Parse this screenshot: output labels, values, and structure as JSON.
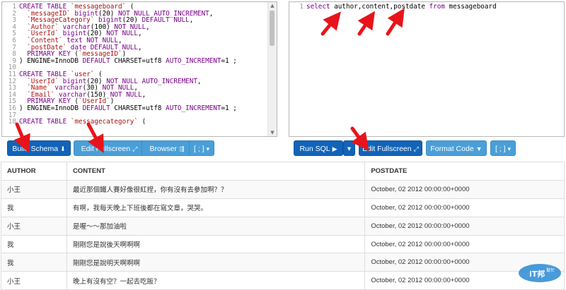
{
  "schema_editor": {
    "line_numbers": [
      "1",
      "2",
      "3",
      "4",
      "5",
      "6",
      "7",
      "8",
      "9",
      "10",
      "11",
      "12",
      "13",
      "14",
      "15",
      "16",
      "17",
      "18"
    ],
    "lines": [
      "CREATE TABLE `messageboard` (",
      "  `messageID` bigint(20) NOT NULL AUTO_INCREMENT,",
      "  `MessageCategory` bigint(20) DEFAULT NULL,",
      "  `Author` varchar(100) NOT NULL,",
      "  `UserId` bigint(20) NOT NULL,",
      "  `Content` text NOT NULL,",
      "  `postDate` date DEFAULT NULL,",
      "  PRIMARY KEY (`messageID`)",
      ") ENGINE=InnoDB DEFAULT CHARSET=utf8 AUTO_INCREMENT=1 ;",
      "",
      "CREATE TABLE `user` (",
      "  `UserId` bigint(20) NOT NULL AUTO_INCREMENT,",
      "  `Name` varchar(30) NOT NULL,",
      "  `Email` varchar(150) NOT NULL,",
      "  PRIMARY KEY (`UserId`)",
      ") ENGINE=InnoDB DEFAULT CHARSET=utf8 AUTO_INCREMENT=1 ;",
      "",
      "CREATE TABLE `messagecategory` ("
    ]
  },
  "sql_editor": {
    "line_number": "1",
    "query": "select author,content,postdate from messageboard"
  },
  "left_toolbar": {
    "build_schema": "Build Schema",
    "edit_fullscreen": "Edit Fullscreen",
    "browser": "Browser",
    "delimiter": "[ ; ]"
  },
  "right_toolbar": {
    "run_sql": "Run SQL",
    "edit_fullscreen": "Edit Fullscreen",
    "format_code": "Format Code",
    "delimiter": "[ ; ]"
  },
  "results": {
    "columns": [
      "AUTHOR",
      "CONTENT",
      "POSTDATE"
    ],
    "rows": [
      [
        "小王",
        "最近那個鐵人賽好像很紅捏，你有沒有去參加啊？？",
        "October, 02 2012 00:00:00+0000"
      ],
      [
        "我",
        "有啊，我每天晚上下班後都在寫文章，哭哭。",
        "October, 02 2012 00:00:00+0000"
      ],
      [
        "小王",
        "是喔～～那加油啦",
        "October, 02 2012 00:00:00+0000"
      ],
      [
        "我",
        "剛剛您是說後天啊啊啊",
        "October, 02 2012 00:00:00+0000"
      ],
      [
        "我",
        "剛剛您是說明天啊啊啊",
        "October, 02 2012 00:00:00+0000"
      ],
      [
        "小王",
        "晚上有沒有空？一起去吃飯？",
        "October, 02 2012 00:00:00+0000"
      ]
    ]
  },
  "watermark": {
    "text1": "iT邦",
    "text2": "幫忙"
  },
  "colors": {
    "button": "#1f7ed0",
    "button_light": "#4a9fd8",
    "arrow": "#e8141b",
    "keyword": "#770088",
    "string": "#aa1111"
  }
}
